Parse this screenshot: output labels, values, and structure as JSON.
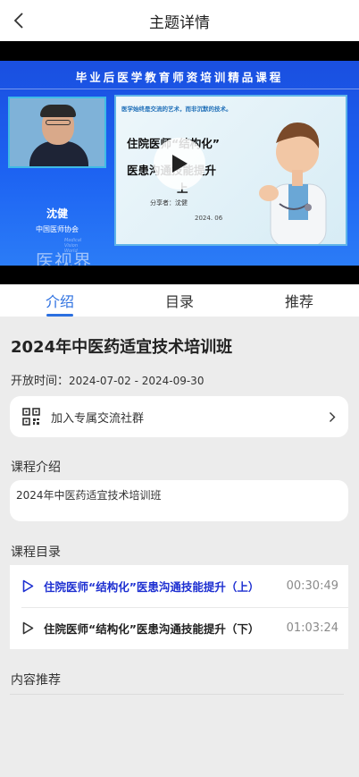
{
  "header": {
    "title": "主题详情"
  },
  "video": {
    "banner": "毕业后医学教育师资培训精品课程",
    "speaker_name": "沈健",
    "speaker_org": "中国医师协会",
    "watermark": "医视界",
    "watermark_en": "Medical Vision World",
    "slide_quote": "医学始终是交流的艺术，而非沉默的技术。",
    "slide_title_1": "住院医师“结构化”",
    "slide_title_2": "医患沟通技能提升",
    "slide_title_3": "上",
    "slide_sharer": "分享者：沈健",
    "slide_date": "2024. 06"
  },
  "tabs": [
    {
      "label": "介绍"
    },
    {
      "label": "目录"
    },
    {
      "label": "推荐"
    }
  ],
  "course": {
    "title": "2024年中医药适宜技术培训班",
    "open_time_label": "开放时间：",
    "open_time_value": "2024-07-02 - 2024-09-30",
    "community_label": "加入专属交流社群",
    "intro_heading": "课程介绍",
    "intro_text": "2024年中医药适宜技术培训班",
    "catalog_heading": "课程目录",
    "catalog": [
      {
        "title": "住院医师“结构化”医患沟通技能提升（上）",
        "duration": "00:30:49"
      },
      {
        "title": "住院医师“结构化”医患沟通技能提升（下）",
        "duration": "01:03:24"
      }
    ],
    "recommend_heading": "内容推荐"
  },
  "colors": {
    "accent": "#2b6fe0",
    "active_item": "#1d2fd1",
    "background": "#ececec"
  }
}
